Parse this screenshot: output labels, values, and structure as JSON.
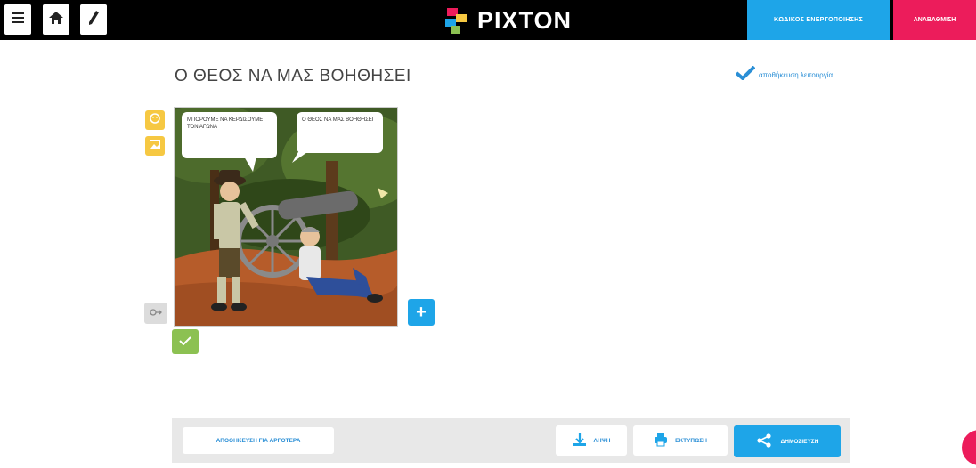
{
  "topbar": {
    "menu_icon": "hamburger-menu-icon",
    "home_icon": "home-icon",
    "edit_icon": "pencil-icon",
    "brand": "PIXTON",
    "activation_button": "ΚΩΔΙΚΟΣ ΕΝΕΡΓΟΠΟΙΗΣΗΣ",
    "upgrade_button": "ΑΝΑΒΑΘΜΙΣΗ"
  },
  "comic": {
    "title": "Ο ΘΕΟΣ ΝΑ ΜΑΣ ΒΟΗΘΗΣΕΙ",
    "saved_label": "αποθήκευση λειτουργία",
    "panel": {
      "bubble_left": "ΜΠΟΡΟΥΜΕ ΝΑ ΚΕΡΔΙΣΟΥΜΕ ΤΟΝ ΑΓΩΝΑ",
      "bubble_right": "Ο ΘΕΟΣ ΝΑ ΜΑΣ ΒΟΗΘΗΣΕΙ"
    },
    "add_panel_label": "+"
  },
  "tools": {
    "character_icon": "character-icon",
    "background_icon": "image-icon",
    "zoom_icon": "zoom-icon",
    "confirm_icon": "check-icon"
  },
  "bottombar": {
    "save_later": "ΑΠΟΘΗΚΕΥΣΗ ΓΙΑ ΑΡΓΟΤΕΡΑ",
    "download": "ΛΗΨΗ",
    "print": "ΕΚΤΥΠΩΣΗ",
    "publish": "ΔΗΜΟΣΙΕΥΣΗ"
  },
  "colors": {
    "accent_blue": "#1ea5e8",
    "accent_pink": "#ec1c5b",
    "tool_yellow": "#f6c842",
    "tool_green": "#8cc152"
  }
}
